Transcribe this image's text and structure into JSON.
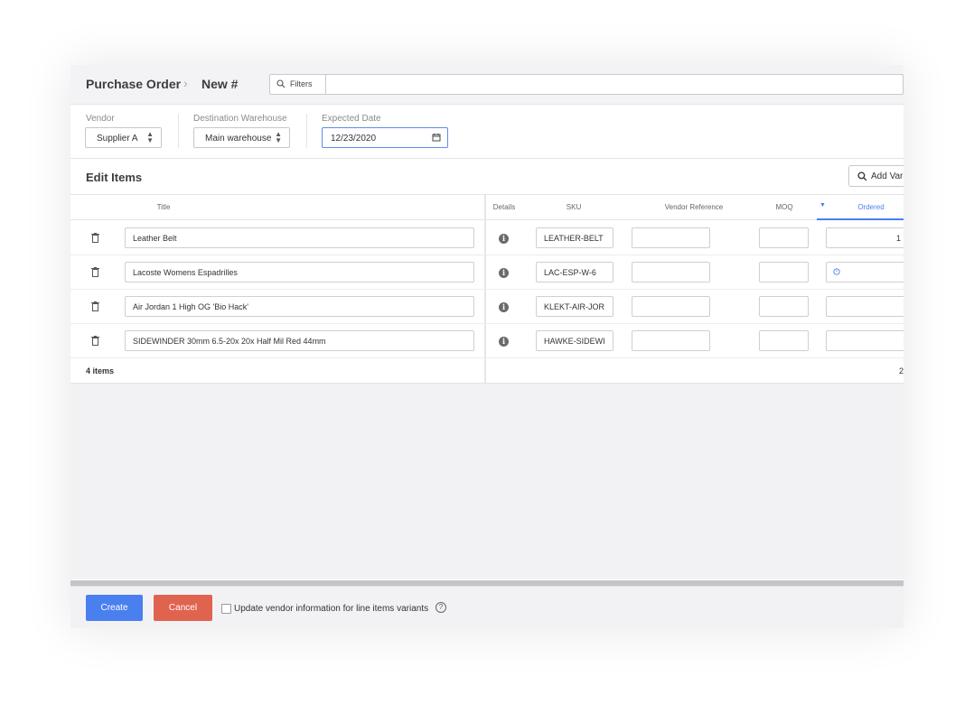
{
  "breadcrumb": {
    "root": "Purchase Order",
    "separator": "›",
    "current": "New #"
  },
  "filters": {
    "label": "Filters",
    "value": ""
  },
  "form": {
    "vendor": {
      "label": "Vendor",
      "value": "Supplier A"
    },
    "warehouse": {
      "label": "Destination Warehouse",
      "value": "Main warehouse"
    },
    "expected_date": {
      "label": "Expected Date",
      "value": "12/23/2020"
    }
  },
  "edit_items": {
    "title": "Edit Items",
    "add_button": "Add Var"
  },
  "columns": {
    "title": "Title",
    "details": "Details",
    "sku": "SKU",
    "vendor_reference": "Vendor Reference",
    "moq": "MOQ",
    "ordered": "Ordered"
  },
  "rows": [
    {
      "title": "Leather Belt",
      "sku": "LEATHER-BELT",
      "vendor_reference": "",
      "moq": "",
      "ordered": "1"
    },
    {
      "title": "Lacoste Womens Espadrilles",
      "sku": "LAC-ESP-W-6",
      "vendor_reference": "",
      "moq": "",
      "ordered": ""
    },
    {
      "title": "Air Jordan 1 High OG 'Bio Hack'",
      "sku": "KLEKT-AIR-JOR",
      "vendor_reference": "",
      "moq": "",
      "ordered": ""
    },
    {
      "title": "SIDEWINDER 30mm 6.5-20x 20x Half Mil Red 44mm",
      "sku": "HAWKE-SIDEWI",
      "vendor_reference": "",
      "moq": "",
      "ordered": ""
    }
  ],
  "footer": {
    "count": "4 items",
    "ordered_total": "2"
  },
  "actions": {
    "create": "Create",
    "cancel": "Cancel",
    "update_vendor_info": "Update vendor information for line items variants",
    "help": "?"
  },
  "colors": {
    "primary": "#4a7fef",
    "danger": "#e0634f",
    "active_tab": "#4a7fef"
  }
}
